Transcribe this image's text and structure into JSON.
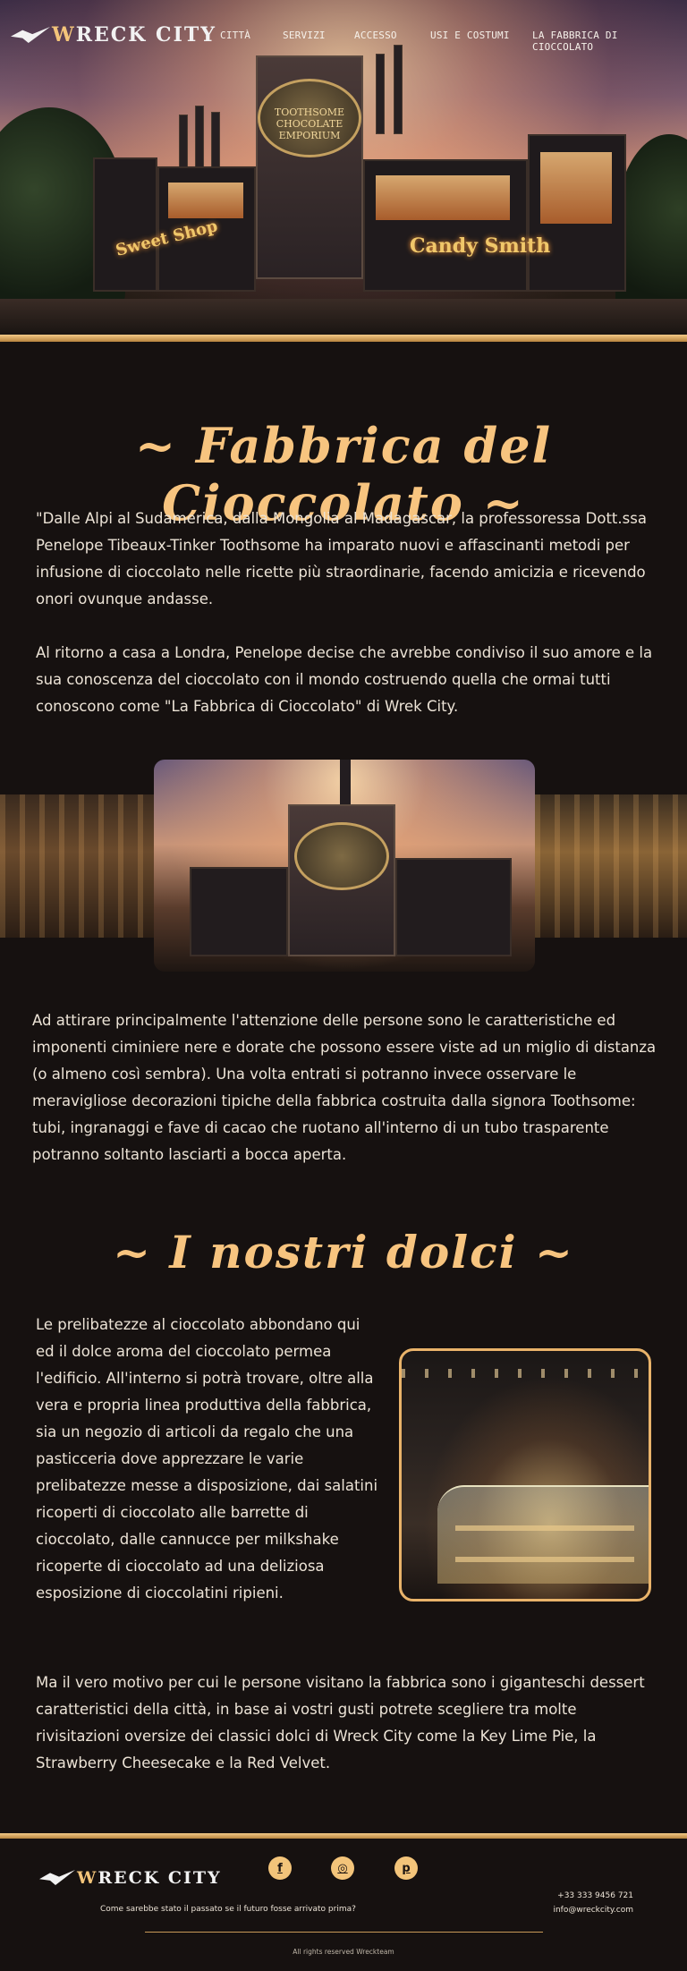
{
  "brand": {
    "logo_left": "W",
    "logo_rest": "RECK CITY"
  },
  "nav": {
    "items": [
      {
        "label": "CITTÀ"
      },
      {
        "label": "SERVIZI"
      },
      {
        "label": "ACCESSO"
      },
      {
        "label": "USI E COSTUMI"
      },
      {
        "label": "LA FABBRICA DI CIOCCOLATO"
      }
    ]
  },
  "hero": {
    "sign_text": "TOOTHSOME CHOCOLATE EMPORIUM",
    "left_sign": "Sweet Shop",
    "right_sign": "Candy Smith"
  },
  "section1": {
    "title": "Fabbrica del Cioccolato",
    "p1": "\"Dalle Alpi al Sudamerica, dalla Mongolia al Madagascar, la professoressa Dott.ssa Penelope Tibeaux-Tinker Toothsome ha imparato nuovi e affascinanti metodi per infusione di cioccolato nelle ricette più straordinarie, facendo amicizia e ricevendo onori ovunque andasse.",
    "p2": "Al ritorno a casa a Londra, Penelope decise che avrebbe condiviso il suo amore e la sua conoscenza del cioccolato con il mondo costruendo quella che ormai tutti conoscono come \"La Fabbrica di Cioccolato\" di Wrek City.",
    "p3": "Ad attirare principalmente l'attenzione delle persone sono le caratteristiche ed imponenti ciminiere nere e dorate che possono essere viste ad un miglio di distanza (o almeno così sembra). Una volta entrati si potranno invece osservare le meravigliose decorazioni tipiche della fabbrica costruita dalla signora Toothsome: tubi, ingranaggi e fave di cacao che ruotano all'interno di un tubo trasparente potranno soltanto lasciarti a bocca aperta."
  },
  "section2": {
    "title": "I nostri dolci",
    "p1": "Le prelibatezze al cioccolato abbondano qui ed il dolce aroma del cioccolato permea l'edificio. All'interno si potrà trovare, oltre alla vera e propria linea produttiva della fabbrica, sia un negozio di articoli da regalo che una pasticceria dove apprezzare le varie prelibatezze messe a disposizione, dai salatini ricoperti di cioccolato alle barrette di cioccolato, dalle cannucce per milkshake ricoperte di cioccolato ad una deliziosa esposizione di cioccolatini ripieni.",
    "p2": "Ma il vero motivo per cui le persone visitano la fabbrica sono i giganteschi dessert caratteristici della città, in base ai vostri gusti potrete scegliere tra molte rivisitazioni oversize dei classici dolci di Wreck City come la Key Lime Pie, la Strawberry Cheesecake e la Red Velvet."
  },
  "footer": {
    "tagline": "Come sarebbe stato il passato se il futuro fosse arrivato prima?",
    "phone": "+33 333 9456 721",
    "email": "info@wreckcity.com",
    "rights": "All rights reserved Wreckteam",
    "social": [
      {
        "icon": "facebook-icon",
        "glyph": "f"
      },
      {
        "icon": "instagram-icon",
        "glyph": "◎"
      },
      {
        "icon": "pinterest-icon",
        "glyph": "p"
      }
    ]
  },
  "colors": {
    "accent": "#f3c47a",
    "background": "#161110",
    "text": "#ece3d6"
  }
}
